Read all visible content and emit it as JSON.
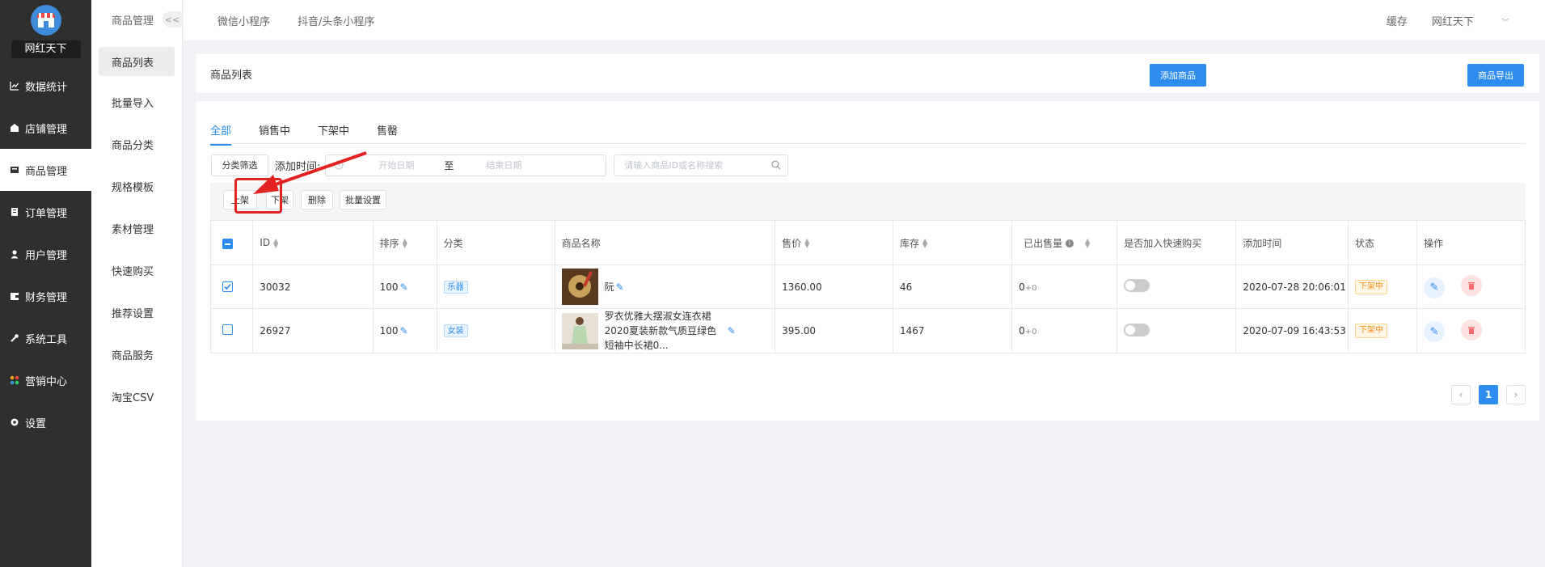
{
  "app": {
    "shop_name": "网红天下"
  },
  "sidebar": {
    "items": [
      {
        "label": "数据统计",
        "icon": "chart-line-icon"
      },
      {
        "label": "店铺管理",
        "icon": "store-icon"
      },
      {
        "label": "商品管理",
        "icon": "inbox-icon"
      },
      {
        "label": "订单管理",
        "icon": "list-icon"
      },
      {
        "label": "用户管理",
        "icon": "user-icon"
      },
      {
        "label": "财务管理",
        "icon": "wallet-icon"
      },
      {
        "label": "系统工具",
        "icon": "wrench-icon"
      },
      {
        "label": "营销中心",
        "icon": "grid-dots-icon"
      },
      {
        "label": "设置",
        "icon": "gear-icon"
      }
    ]
  },
  "subnav": {
    "title": "商品管理",
    "collapse_label": "<<",
    "items": [
      "商品列表",
      "批量导入",
      "商品分类",
      "规格模板",
      "素材管理",
      "快速购买",
      "推荐设置",
      "商品服务",
      "淘宝CSV"
    ]
  },
  "topbar": {
    "tabs": [
      "微信小程序",
      "抖音/头条小程序"
    ],
    "cache_label": "缓存",
    "user_label": "网红天下"
  },
  "header": {
    "title": "商品列表",
    "add_label": "添加商品",
    "export_label": "商品导出"
  },
  "tabs": [
    "全部",
    "销售中",
    "下架中",
    "售罄"
  ],
  "filter": {
    "category_btn": "分类筛选",
    "time_label": "添加时间:",
    "start_placeholder": "开始日期",
    "to_label": "至",
    "end_placeholder": "结束日期",
    "search_placeholder": "请输入商品ID或名称搜索"
  },
  "actions": {
    "on_shelf": "上架",
    "off_shelf": "下架",
    "delete": "删除",
    "batch": "批量设置"
  },
  "table": {
    "headers": {
      "id": "ID",
      "sort": "排序",
      "category": "分类",
      "name": "商品名称",
      "price": "售价",
      "stock": "库存",
      "sold": "已出售量",
      "quick_buy": "是否加入快速购买",
      "added": "添加时间",
      "status": "状态",
      "ops": "操作"
    },
    "rows": [
      {
        "id": "30032",
        "sort": "100",
        "category": "乐器",
        "name": "阮",
        "price": "1360.00",
        "stock": "46",
        "sold": "0",
        "sold_extra": "+0",
        "added": "2020-07-28 20:06:01",
        "status": "下架中",
        "checked": true
      },
      {
        "id": "26927",
        "sort": "100",
        "category": "女装",
        "name": "罗衣优雅大摆淑女连衣裙2020夏装新款气质豆绿色短袖中长裙0...",
        "price": "395.00",
        "stock": "1467",
        "sold": "0",
        "sold_extra": "+0",
        "added": "2020-07-09 16:43:53",
        "status": "下架中",
        "checked": false
      }
    ]
  },
  "pagination": {
    "current": "1"
  },
  "colors": {
    "primary": "#2d8cf0",
    "sidebar": "#2f2f2f",
    "highlight": "#e32222"
  }
}
